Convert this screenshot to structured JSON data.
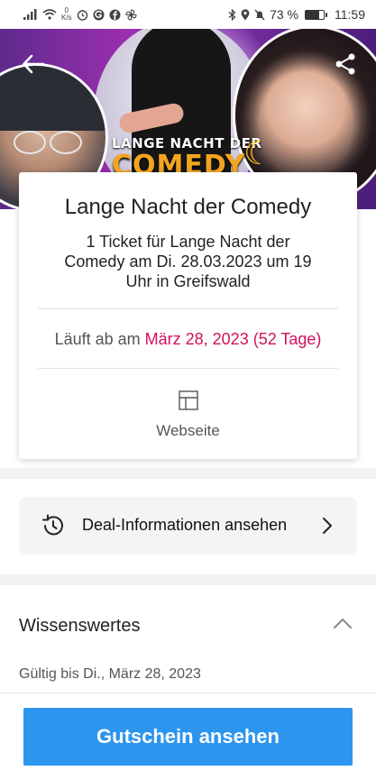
{
  "status_bar": {
    "net_speed_value": "0",
    "net_speed_unit": "K/s",
    "battery_percent_label": "73 %",
    "battery_level": 0.73,
    "time": "11:59",
    "icons": [
      "signal-icon",
      "wifi-icon",
      "alarm-icon",
      "google-icon",
      "facebook-icon",
      "pinwheel-icon",
      "bluetooth-icon",
      "location-icon",
      "mute-icon",
      "battery-icon"
    ]
  },
  "hero": {
    "title_top": "LANGE NACHT DER",
    "title_bottom": "COMEDY",
    "icons": [
      "back-arrow-icon",
      "share-icon"
    ]
  },
  "deal_card": {
    "title": "Lange Nacht der Comedy",
    "subtitle": "1 Ticket für Lange Nacht der Comedy am Di. 28.03.2023 um 19 Uhr in Greifswald",
    "expires_prefix": "Läuft ab am",
    "expires_date": "März 28, 2023 (52 Tage)",
    "website_label": "Webseite",
    "accent_color": "#d0115a"
  },
  "deal_info": {
    "label": "Deal-Informationen ansehen"
  },
  "facts": {
    "title": "Wissenswertes",
    "valid_until": "Gültig bis Di., März 28, 2023"
  },
  "cta": {
    "label": "Gutschein ansehen",
    "color": "#2c95ee"
  }
}
